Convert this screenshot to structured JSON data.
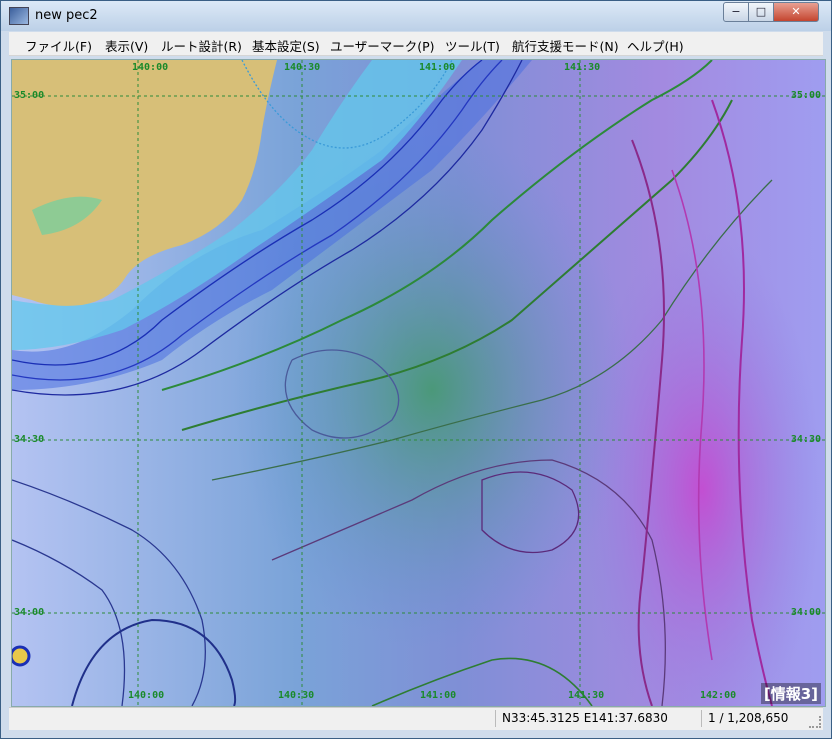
{
  "window": {
    "title": "new pec2",
    "minimize": "−",
    "maximize": "□",
    "close": "✕"
  },
  "menu": [
    "ファイル(F)",
    "表示(V)",
    "ルート設計(R)",
    "基本設定(S)",
    "ユーザーマーク(P)",
    "ツール(T)",
    "航行支援モード(N)",
    "ヘルプ(H)"
  ],
  "map": {
    "grid_labels_top": [
      "140:00",
      "140:30",
      "141:00",
      "141:30"
    ],
    "grid_labels_bottom": [
      "140:00",
      "140:30",
      "141:00",
      "141:30",
      "142:00"
    ],
    "grid_labels_right": [
      "35:00",
      "34:30",
      "34:00"
    ],
    "grid_labels_left": [
      "35:00",
      "34:30",
      "34:00"
    ],
    "info_label": "[情報3]",
    "colors": {
      "land": "#d8c07a",
      "shallow": "#4fc3e8",
      "deep_blue": "#1a2fb5",
      "green": "#2e8b2e",
      "magenta": "#b02aa8",
      "sea": "#a3b4ee"
    }
  },
  "status": {
    "position": "N33:45.3125 E141:37.6830",
    "scale": "1 / 1,208,650"
  }
}
